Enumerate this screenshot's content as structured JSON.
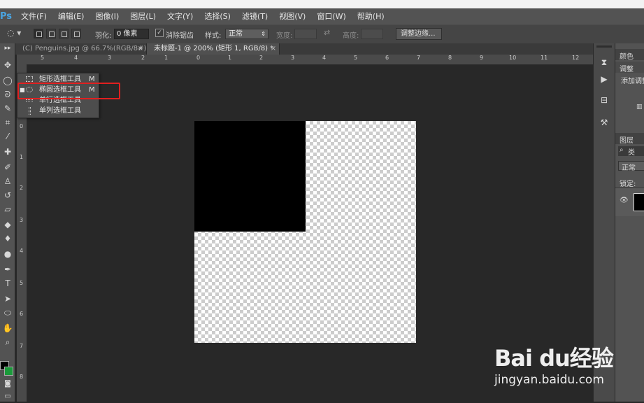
{
  "menubar": {
    "logo": "Ps",
    "items": [
      "文件(F)",
      "编辑(E)",
      "图像(I)",
      "图层(L)",
      "文字(Y)",
      "选择(S)",
      "滤镜(T)",
      "视图(V)",
      "窗口(W)",
      "帮助(H)"
    ]
  },
  "options": {
    "feather_label": "羽化:",
    "feather_value": "0 像素",
    "antialias_label": "消除锯齿",
    "antialias_checked": true,
    "style_label": "样式:",
    "style_value": "正常",
    "width_label": "宽度:",
    "height_label": "高度:",
    "refine_button": "调整边缘..."
  },
  "tabs": [
    {
      "label": "(C) Penguins.jpg @ 66.7%(RGB/8#)",
      "close": "×",
      "active": false
    },
    {
      "label": "未标题-1 @ 200% (矩形 1, RGB/8) *",
      "close": "×",
      "active": true
    }
  ],
  "ruler": {
    "h_ticks": [
      "5",
      "4",
      "3",
      "2",
      "1",
      "0",
      "1",
      "2",
      "3",
      "4",
      "5",
      "6",
      "7",
      "8",
      "9",
      "10",
      "11",
      "12"
    ],
    "v_ticks": [
      "0",
      "1",
      "2",
      "3",
      "4",
      "5",
      "6",
      "7",
      "8"
    ]
  },
  "flyout": {
    "items": [
      {
        "label": "矩形选框工具",
        "key": "M",
        "selected": false
      },
      {
        "label": "椭圆选框工具",
        "key": "M",
        "selected": true
      },
      {
        "label": "单行选框工具",
        "key": "",
        "selected": false
      },
      {
        "label": "单列选框工具",
        "key": "",
        "selected": false
      }
    ]
  },
  "right_panel": {
    "color_tab": "颜色",
    "adjust_tab": "调整",
    "add_adjust": "添加调整",
    "layers_tab": "图层",
    "search_kind": "类",
    "blend_mode": "正常",
    "lock_label": "锁定:"
  },
  "watermark": {
    "logo": "Bai du经验",
    "url": "jingyan.baidu.com"
  },
  "colors": {
    "accent": "#4aa3df",
    "highlight": "#e02020",
    "foreground": "#000000",
    "background": "#1a9a3a"
  }
}
